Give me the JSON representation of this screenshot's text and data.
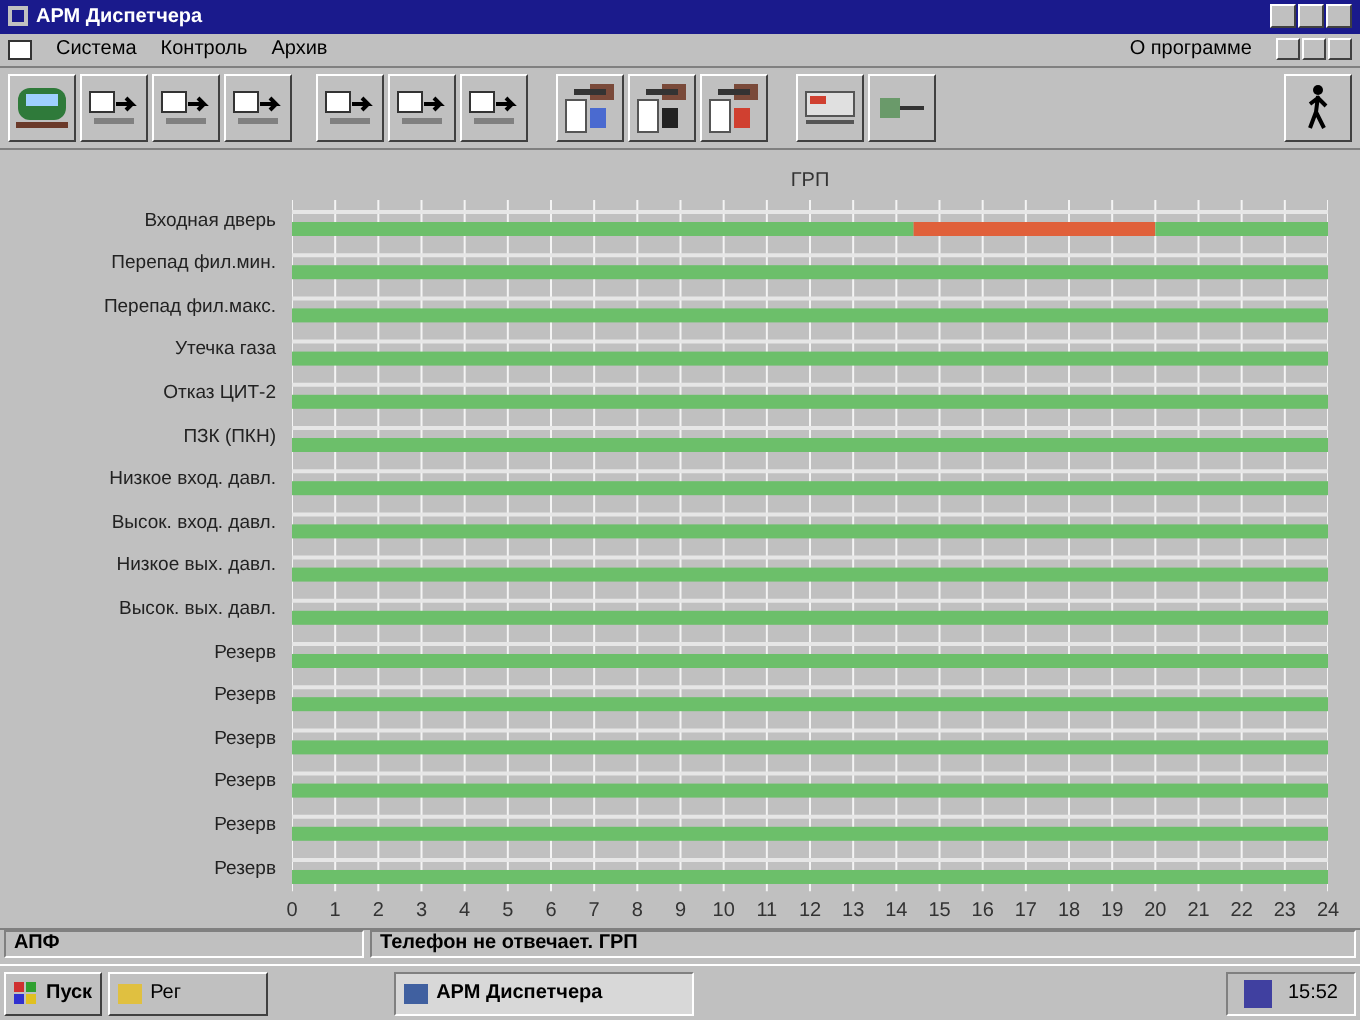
{
  "window": {
    "title": "АРМ Диспетчера"
  },
  "menu": [
    "Система",
    "Контроль",
    "Архив"
  ],
  "menu_right": "О программе",
  "chart": {
    "chart_data": {
      "type": "bar",
      "orientation": "horizontal",
      "stacked": true,
      "title": "ГРП",
      "categories": [
        "Входная дверь",
        "Перепад фил.мин.",
        "Перепад фил.макс.",
        "Утечка газа",
        "Отказ ЦИТ-2",
        "ПЗК (ПКН)",
        "Низкое вход. давл.",
        "Высок. вход. давл.",
        "Низкое вых. давл.",
        "Высок. вых. давл.",
        "Резерв",
        "Резерв",
        "Резерв",
        "Резерв",
        "Резерв",
        "Резерв"
      ],
      "series": [
        {
          "color": "#6cbf6a",
          "values": [
            14.4,
            24,
            24,
            24,
            24,
            24,
            24,
            24,
            24,
            24,
            24,
            24,
            24,
            24,
            24,
            24
          ]
        },
        {
          "color": "#e0603a",
          "values": [
            5.6,
            0,
            0,
            0,
            0,
            0,
            0,
            0,
            0,
            0,
            0,
            0,
            0,
            0,
            0,
            0
          ]
        },
        {
          "color": "#6cbf6a",
          "values": [
            4,
            0,
            0,
            0,
            0,
            0,
            0,
            0,
            0,
            0,
            0,
            0,
            0,
            0,
            0,
            0
          ]
        }
      ],
      "xlim": [
        0,
        24
      ],
      "grid": true,
      "xticks": [
        0,
        1,
        2,
        3,
        4,
        5,
        6,
        7,
        8,
        9,
        10,
        11,
        12,
        13,
        14,
        15,
        16,
        17,
        18,
        19,
        20,
        21,
        22,
        23,
        24
      ]
    }
  },
  "status_bar": [
    "АПФ",
    "Телефон не отвечает. ГРП"
  ],
  "taskbar": {
    "start": "Пуск",
    "items": [
      {
        "label": "Рег",
        "selected": false
      },
      {
        "label": "АРМ Диспетчера",
        "selected": true
      }
    ],
    "clock": "15:52"
  }
}
